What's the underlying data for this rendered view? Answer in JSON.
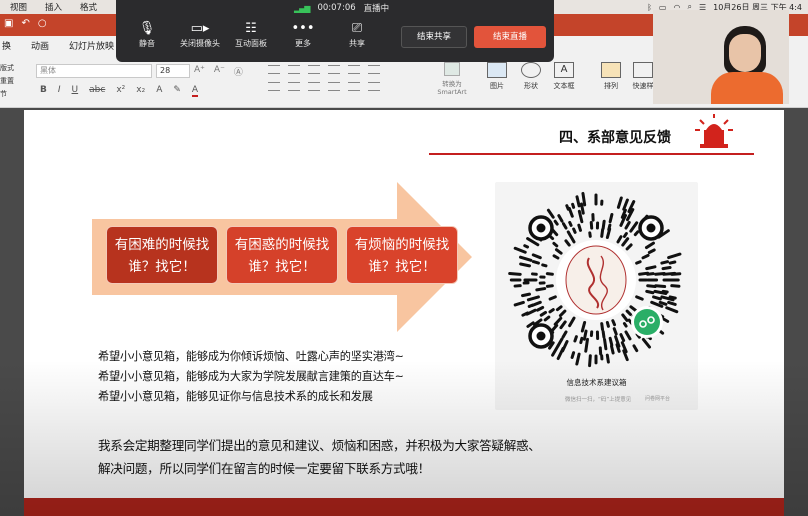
{
  "menubar": {
    "items": [
      "视图",
      "插入",
      "格式"
    ],
    "clock": "10月26日 周三 下午 4:4"
  },
  "ribbon": {
    "tabs": [
      "换",
      "动画",
      "幻灯片放映"
    ],
    "left_stub": [
      "版式",
      "重置",
      "节"
    ],
    "font_name": "黑体",
    "font_size": "28",
    "smartart_label": "转换为 SmartArt",
    "buttons": [
      "图片",
      "形状",
      "文本框",
      "排列",
      "快速样"
    ]
  },
  "meeting": {
    "elapsed": "00:07:06",
    "status": "直播中",
    "controls": [
      {
        "label": "静音",
        "icon": "microphone-icon"
      },
      {
        "label": "关闭摄像头",
        "icon": "camera-icon"
      },
      {
        "label": "互动面板",
        "icon": "chat-panel-icon"
      },
      {
        "label": "更多",
        "icon": "more-icon"
      },
      {
        "label": "共享",
        "icon": "share-screen-icon"
      }
    ],
    "end_share_label": "结束共享",
    "end_live_label": "结束直播",
    "accent": "#e2543b",
    "signal_color": "#38c25a"
  },
  "slide": {
    "title": "四、系部意见反馈",
    "accent": "#c41f1f",
    "arrow_color": "#f8c5a0",
    "pills": [
      {
        "line1": "有困难的时候找",
        "line2": "谁？找它！"
      },
      {
        "line1": "有困惑的时候找",
        "line2": "谁？找它！"
      },
      {
        "line1": "有烦恼的时候找",
        "line2": "谁？找它！"
      }
    ],
    "lines": [
      "希望小小意见箱，能够成为你倾诉烦恼、吐露心声的坚实港湾~",
      "希望小小意见箱，能够成为大家为学院发展献言建策的直达车~",
      "希望小小意见箱，能够见证你与信息技术系的成长和发展"
    ],
    "note": [
      "我系会定期整理同学们提出的意见和建议、烦恼和困惑，并积极为大家答疑解惑、",
      "解决问题，所以同学们在留言的时候一定要留下联系方式哦！"
    ],
    "qr": {
      "caption": "信息技术系建议箱",
      "sub": "微信扫一扫，“码”上提意见",
      "brand": "问卷网平台"
    }
  }
}
